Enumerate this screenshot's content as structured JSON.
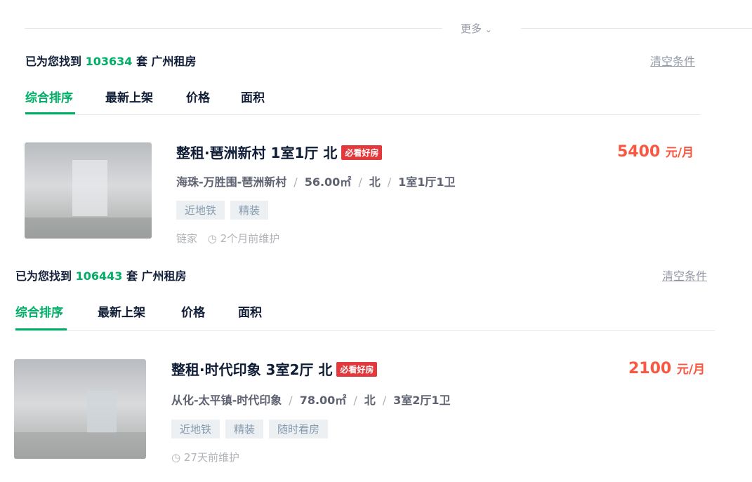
{
  "more_label": "更多",
  "panels": [
    {
      "found_prefix": "已为您找到",
      "count": "103634",
      "found_suffix": "套 广州租房",
      "clear_label": "清空条件",
      "tabs": [
        "综合排序",
        "最新上架",
        "价格",
        "面积"
      ],
      "listing": {
        "title": "整租·琶洲新村 1室1厅 北",
        "badge": "必看好房",
        "price": "5400",
        "unit": "元/月",
        "district": "海珠-万胜围-琶洲新村",
        "area": "56.00㎡",
        "orientation": "北",
        "layout": "1室1厅1卫",
        "tags": [
          "近地铁",
          "精装"
        ],
        "agency": "链家",
        "maintained": "2个月前维护"
      }
    },
    {
      "found_prefix": "已为您找到",
      "count": "106443",
      "found_suffix": "套 广州租房",
      "clear_label": "清空条件",
      "tabs": [
        "综合排序",
        "最新上架",
        "价格",
        "面积"
      ],
      "listing": {
        "title": "整租·时代印象 3室2厅 北",
        "badge": "必看好房",
        "price": "2100",
        "unit": "元/月",
        "district": "从化-太平镇-时代印象",
        "area": "78.00㎡",
        "orientation": "北",
        "layout": "3室2厅1卫",
        "tags": [
          "近地铁",
          "精装",
          "随时看房"
        ],
        "maintained": "27天前维护"
      }
    }
  ]
}
